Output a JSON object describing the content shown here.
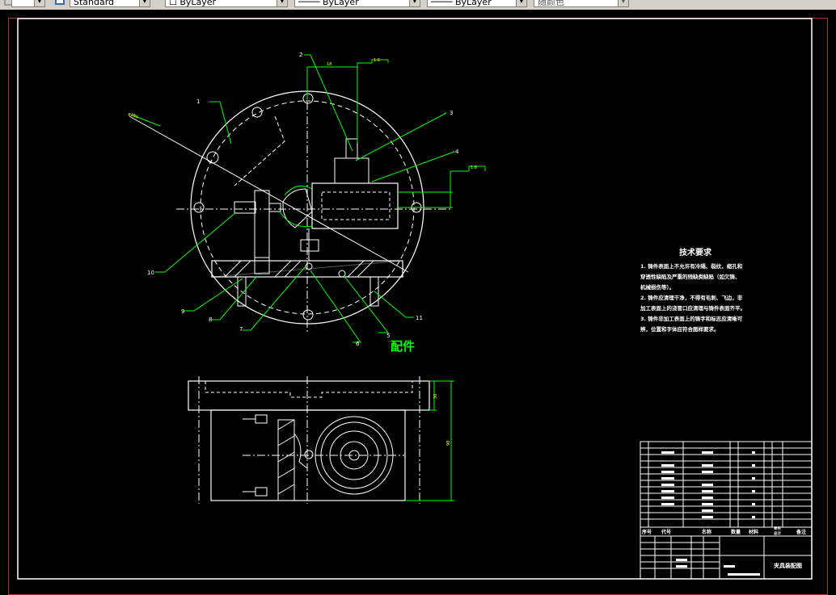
{
  "toolbar": {
    "textstyle_value": "Standard",
    "layer_value": "ByLayer",
    "linetype_value": "ByLayer",
    "lineweight_value": "ByLayer",
    "color_value": "随颜色"
  },
  "drawing": {
    "view_label": "配件",
    "tech_title": "技术要求",
    "tech_lines": [
      "1. 铸件表面上不允许有冷隔、裂纹、缩孔和",
      "穿透性缺陷及严重的残缺类缺陷（如欠铸、",
      "机械损伤等）。",
      "2. 铸件应清理干净，不得有毛刺、飞边，非",
      "加工表面上的浇冒口应清理与铸件表面齐平。",
      "3. 铸件非加工表面上的铸字和标志应清晰可",
      "辨，位置和字体应符合图样要求。"
    ],
    "balloons": [
      "1",
      "2",
      "3",
      "4",
      "5",
      "6",
      "7",
      "8",
      "9",
      "10",
      "11"
    ],
    "dims": {
      "top": "18",
      "top_frame": "1.6",
      "right_frame": "1.6",
      "angle": "φ300",
      "side_h": "30",
      "side_total": "98"
    },
    "title_block": {
      "headers": [
        "序号",
        "代号",
        "名称",
        "数量",
        "材料",
        "单件",
        "总计",
        "备注"
      ],
      "drawing_name": "夹具装配图"
    }
  },
  "colors": {
    "line_white": "#ffffff",
    "line_green": "#00ff00",
    "line_yellow": "#ffff00",
    "frame_red": "#b0303a"
  }
}
